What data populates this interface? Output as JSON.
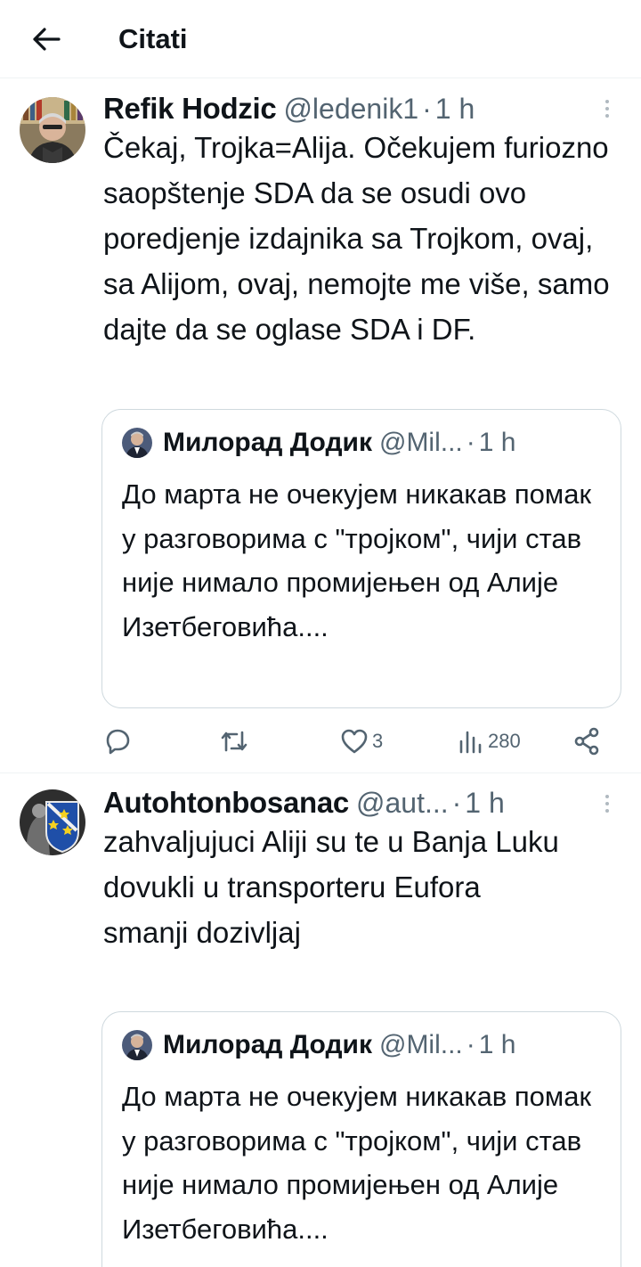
{
  "header": {
    "title": "Citati"
  },
  "tweets": [
    {
      "name": "Refik Hodzic",
      "handle": "@ledenik1",
      "time": "1 h",
      "text": "Čekaj, Trojka=Alija. Očekujem furiozno saopštenje SDA da se osudi ovo poredjenje izdajnika sa Trojkom, ovaj, sa Alijom, ovaj, nemojte me više, samo dajte da se oglase SDA i DF.",
      "quote": {
        "name": "Милорад Додик",
        "handle": "@Mil...",
        "time": "1 h",
        "text": "До марта не очекујем никакав помак у разговорима с \"тројком\", чији став није нимало промијењен од Алије Изетбеговића...."
      },
      "stats": {
        "replies": "",
        "retweets": "",
        "likes": "3",
        "views": "280"
      }
    },
    {
      "name": "Autohtonbosanac",
      "handle": "@aut...",
      "time": "1 h",
      "text": "zahvaljujuci Aliji su te u Banja Luku dovukli u transporteru Eufora\nsmanji dozivljaj",
      "quote": {
        "name": "Милорад Додик",
        "handle": "@Mil...",
        "time": "1 h",
        "text": "До марта не очекујем никакав помак у разговорима с \"тројком\", чији став није нимало промијењен од Алије Изетбеговића...."
      }
    }
  ]
}
